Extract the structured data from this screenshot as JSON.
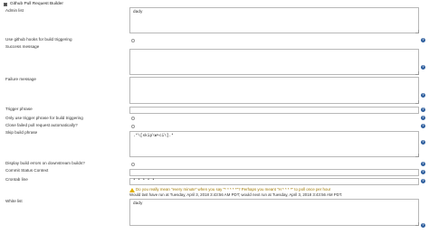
{
  "header": {
    "title": "Github Pull Request Builder",
    "checked": true
  },
  "fields": {
    "admin_list": {
      "label": "Admin list",
      "value": "dady"
    },
    "use_hooks": {
      "label": "Use github hooks for build triggering"
    },
    "success_message": {
      "label": "Success message",
      "value": ""
    },
    "failure_message": {
      "label": "Failure message",
      "value": ""
    },
    "trigger_phrase": {
      "label": "Trigger phrase",
      "value": ""
    },
    "only_trigger_phrase": {
      "label": "Only use trigger phrase for build triggering"
    },
    "close_failed": {
      "label": "Close failed pull request automatically?"
    },
    "skip_phrase": {
      "label": "Skip build phrase",
      "value": ".*\\[skip\\W+ci\\].*"
    },
    "display_errors": {
      "label": "Display build errors on downstream builds?"
    },
    "commit_status": {
      "label": "Commit Status Context",
      "value": ""
    },
    "crontab": {
      "label": "Crontab line",
      "value": "* * * * *"
    },
    "crontab_warning": "Do you really mean \"every minute\" when you say \"* * * * *\"? Perhaps you meant \"H * * * *\" to poll once per hour",
    "crontab_info": "Would last have run at Tuesday, April 3, 2018 3:43:56 AM PDT; would next run at Tuesday, April 3, 2018 3:43:56 AM PDT.",
    "white_list": {
      "label": "White list",
      "value": "dady"
    }
  },
  "icons": {
    "help": "?"
  },
  "colors": {
    "help_bg": "#2f5f9e",
    "warning": "#e0b000"
  }
}
